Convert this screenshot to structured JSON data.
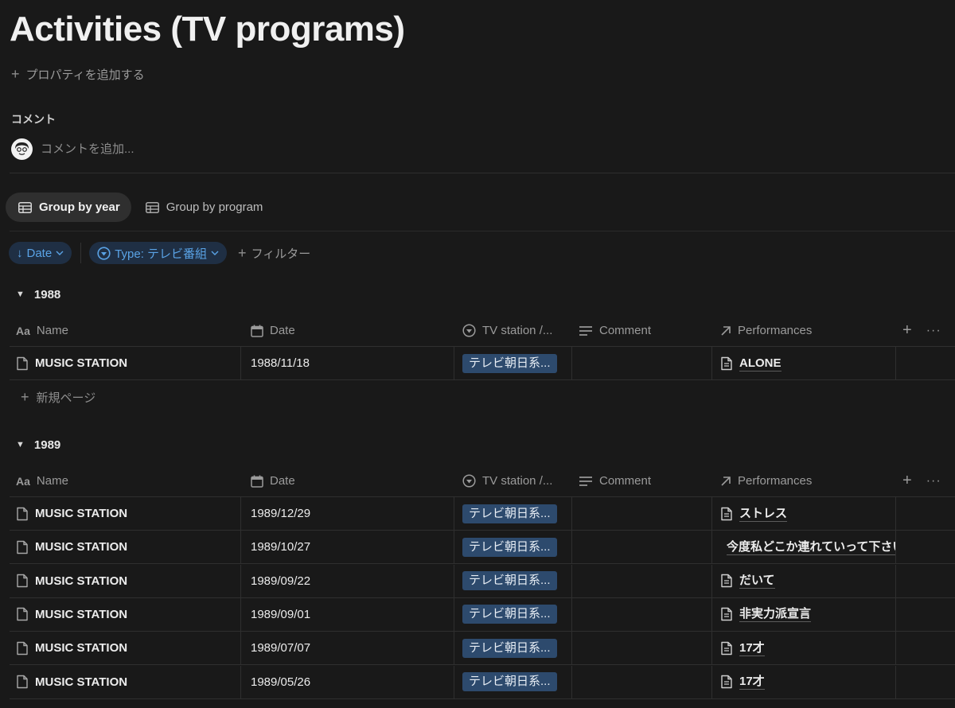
{
  "page": {
    "title": "Activities (TV programs)",
    "add_property_label": "プロパティを追加する",
    "comments_heading": "コメント",
    "comment_placeholder": "コメントを追加..."
  },
  "views": [
    {
      "label": "Group by year",
      "active": true,
      "icon": "table-icon"
    },
    {
      "label": "Group by program",
      "active": false,
      "icon": "table-icon"
    }
  ],
  "filters": {
    "sort_chip": "Date",
    "type_chip": "Type: テレビ番組",
    "add_filter": "フィルター"
  },
  "columns": {
    "name": "Name",
    "date": "Date",
    "tv": "TV station /...",
    "comment": "Comment",
    "performances": "Performances"
  },
  "groups": [
    {
      "year": "1988",
      "rows": [
        {
          "name": "MUSIC STATION",
          "date": "1988/11/18",
          "tv": "テレビ朝日系...",
          "comment": "",
          "performance": "ALONE"
        }
      ],
      "new_page_label": "新規ページ"
    },
    {
      "year": "1989",
      "rows": [
        {
          "name": "MUSIC STATION",
          "date": "1989/12/29",
          "tv": "テレビ朝日系...",
          "comment": "",
          "performance": "ストレス"
        },
        {
          "name": "MUSIC STATION",
          "date": "1989/10/27",
          "tv": "テレビ朝日系...",
          "comment": "",
          "performance": "今度私どこか連れていって下さいな"
        },
        {
          "name": "MUSIC STATION",
          "date": "1989/09/22",
          "tv": "テレビ朝日系...",
          "comment": "",
          "performance": "だいて"
        },
        {
          "name": "MUSIC STATION",
          "date": "1989/09/01",
          "tv": "テレビ朝日系...",
          "comment": "",
          "performance": "非実力派宣言"
        },
        {
          "name": "MUSIC STATION",
          "date": "1989/07/07",
          "tv": "テレビ朝日系...",
          "comment": "",
          "performance": "17才"
        },
        {
          "name": "MUSIC STATION",
          "date": "1989/05/26",
          "tv": "テレビ朝日系...",
          "comment": "",
          "performance": "17才"
        }
      ]
    }
  ],
  "colors": {
    "background": "#191919",
    "chip_bg": "#1f2f44",
    "chip_text": "#5aa3e6",
    "tag_bg": "#2d4a6d"
  }
}
